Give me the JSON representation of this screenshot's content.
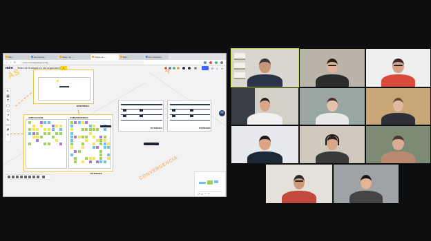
{
  "browser": {
    "tabs": [
      "Miro",
      "Reuniones",
      "Taller de ...",
      "Mapa de ...",
      "Miro",
      "Documentos"
    ],
    "url": "miro.com/app/board/o9J_...",
    "nav": {
      "back": "‹",
      "forward": "›",
      "reload": "↻"
    }
  },
  "miro": {
    "logo": "miro",
    "board_title": "Taller de Ecología en las organizaciones",
    "board_button": "✎"
  },
  "canvas": {
    "frames": {
      "top": {
        "label": "DESPENSA"
      },
      "main": {
        "label": "ESTIBADA",
        "col_a": "AMPLIACIÓN",
        "col_b": "CONVERGENCIA"
      },
      "mid": {
        "label": "ESTIBADA"
      },
      "right": {
        "label": "ESTIBADA"
      }
    },
    "big_words": {
      "convergencia": "CONVERGENCIA"
    },
    "tooltip": "Nombre",
    "chat_icon": "✉"
  },
  "colors": {
    "sticky_yellow": "#f6e35a",
    "sticky_green": "#9fd25a",
    "sticky_blue": "#6cc3e6",
    "sticky_purple": "#a979c9",
    "frame_border": "#e8c548",
    "accent_orange": "#f19a3e",
    "active_speaker": "#c8e64a"
  },
  "participants": [
    {
      "id": "p1",
      "active": true
    },
    {
      "id": "p2"
    },
    {
      "id": "p3"
    },
    {
      "id": "p4"
    },
    {
      "id": "p5"
    },
    {
      "id": "p6"
    },
    {
      "id": "p7"
    },
    {
      "id": "p8"
    },
    {
      "id": "p9"
    },
    {
      "id": "p10"
    },
    {
      "id": "p11"
    }
  ]
}
